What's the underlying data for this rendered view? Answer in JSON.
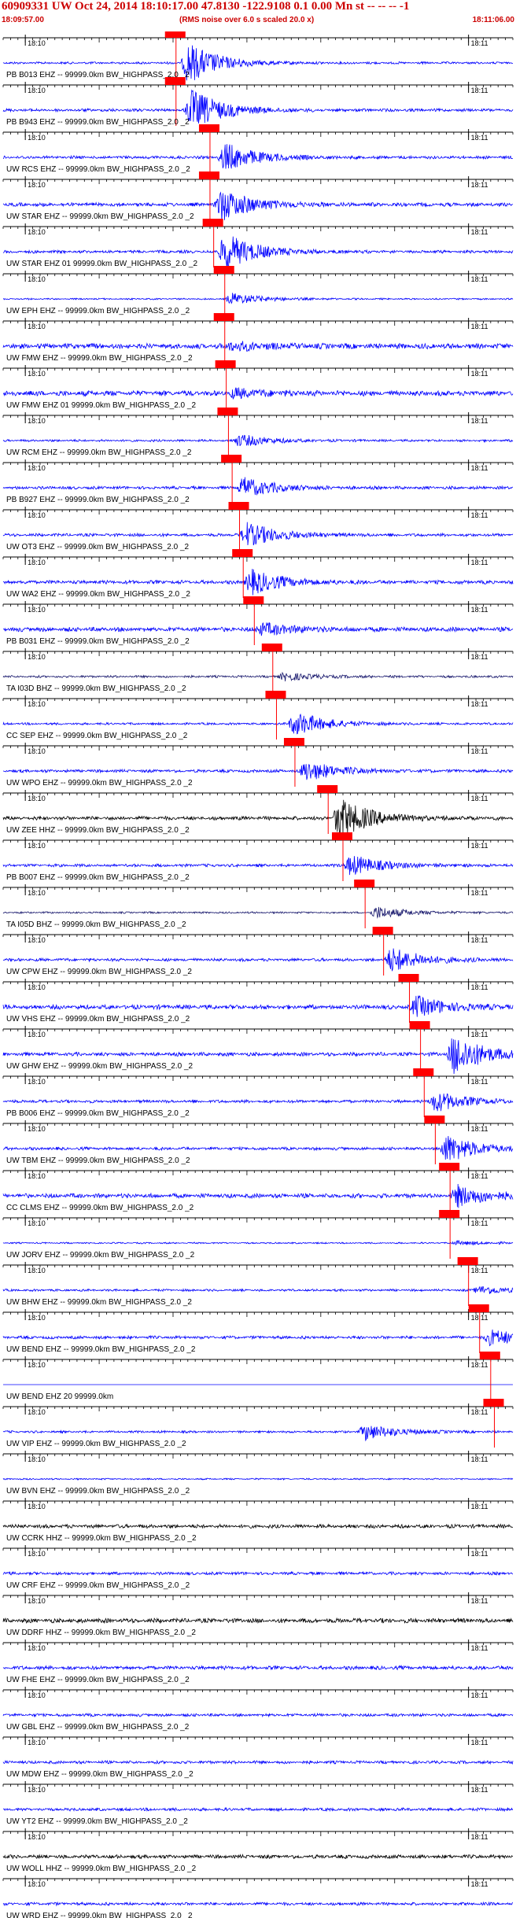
{
  "header": {
    "title": "60909331 UW Oct 24, 2014 18:10:17.00   47.8130 -122.9108  0.1 0.00 Mn st -- -- --  -1",
    "start_time": "18:09:57.00",
    "note": "(RMS noise over 6.0 s scaled 20.0 x)",
    "end_time": "18:11:06.00"
  },
  "colors": {
    "trace_default": "#0000ff",
    "trace_black": "#000000",
    "trace_dark": "#1a1a6e",
    "pick_box": "#ff0000",
    "pick_line": "#ff0000",
    "header_text": "#cc0000",
    "grid": "#000000"
  },
  "chart_data": {
    "type": "line",
    "title": "60909331 UW Oct 24, 2014 18:10:17.00   47.8130 -122.9108  0.1 0.00 Mn st -- -- --  -1",
    "time_window": [
      "18:09:57.00",
      "18:11:06.00"
    ],
    "tick_labels": [
      "18:10",
      "18:11"
    ],
    "ylabel": "",
    "traces": [
      {
        "label": "PB B013 EHZ -- 99999.0km BW_HIGHPASS_2.0 _2",
        "color": "#0000ff",
        "pick": "18:10:20.4",
        "event_time": "18:10:22.0",
        "event_amp": 1.0,
        "noise": 0.15
      },
      {
        "label": "PB B943 EHZ -- 99999.0km BW_HIGHPASS_2.0 _2",
        "color": "#0000ff",
        "pick": "18:10:20.4",
        "event_time": "18:10:22.5",
        "event_amp": 1.0,
        "noise": 0.2
      },
      {
        "label": "UW RCS EHZ -- 99999.0km BW_HIGHPASS_2.0 _2",
        "color": "#0000ff",
        "pick": "18:10:25.0",
        "event_time": "18:10:27.0",
        "event_amp": 0.7,
        "noise": 0.2
      },
      {
        "label": "UW STAR EHZ -- 99999.0km BW_HIGHPASS_2.0 _2",
        "color": "#0000ff",
        "pick": "18:10:25.0",
        "event_time": "18:10:26.5",
        "event_amp": 0.8,
        "noise": 0.25
      },
      {
        "label": "UW STAR EHZ 01 99999.0km BW_HIGHPASS_2.0 _2",
        "color": "#0000ff",
        "pick": "18:10:25.5",
        "event_time": "18:10:27.0",
        "event_amp": 0.9,
        "noise": 0.2
      },
      {
        "label": "UW EPH EHZ -- 99999.0km BW_HIGHPASS_2.0 _2",
        "color": "#0000ff",
        "pick": "18:10:27.0",
        "event_time": "18:10:28.0",
        "event_amp": 0.3,
        "noise": 0.1
      },
      {
        "label": "UW FMW EHZ -- 99999.0km BW_HIGHPASS_2.0 _2",
        "color": "#0000ff",
        "pick": "18:10:27.0",
        "event_time": "18:10:28.0",
        "event_amp": 0.2,
        "noise": 0.35
      },
      {
        "label": "UW FMW EHZ 01 99999.0km BW_HIGHPASS_2.0 _2",
        "color": "#0000ff",
        "pick": "18:10:27.2",
        "event_time": "18:10:28.2",
        "event_amp": 0.2,
        "noise": 0.35
      },
      {
        "label": "UW RCM EHZ -- 99999.0km BW_HIGHPASS_2.0 _2",
        "color": "#0000ff",
        "pick": "18:10:27.5",
        "event_time": "18:10:29.0",
        "event_amp": 0.3,
        "noise": 0.15
      },
      {
        "label": "PB B927 EHZ -- 99999.0km BW_HIGHPASS_2.0 _2",
        "color": "#0000ff",
        "pick": "18:10:28.0",
        "event_time": "18:10:29.5",
        "event_amp": 0.5,
        "noise": 0.2
      },
      {
        "label": "UW OT3 EHZ -- 99999.0km BW_HIGHPASS_2.0 _2",
        "color": "#0000ff",
        "pick": "18:10:29.0",
        "event_time": "18:10:30.0",
        "event_amp": 0.6,
        "noise": 0.2
      },
      {
        "label": "UW WA2 EHZ -- 99999.0km BW_HIGHPASS_2.0 _2",
        "color": "#0000ff",
        "pick": "18:10:29.5",
        "event_time": "18:10:30.5",
        "event_amp": 0.6,
        "noise": 0.25
      },
      {
        "label": "PB B031 EHZ -- 99999.0km BW_HIGHPASS_2.0 _2",
        "color": "#0000ff",
        "pick": "18:10:31.0",
        "event_time": "18:10:32.0",
        "event_amp": 0.3,
        "noise": 0.3
      },
      {
        "label": "TA I03D BHZ -- 99999.0km BW_HIGHPASS_2.0 _2",
        "color": "#1a1a6e",
        "pick": "18:10:33.5",
        "event_time": "18:10:35.0",
        "event_amp": 0.2,
        "noise": 0.15
      },
      {
        "label": "CC SEP EHZ -- 99999.0km BW_HIGHPASS_2.0 _2",
        "color": "#0000ff",
        "pick": "18:10:34.0",
        "event_time": "18:10:36.5",
        "event_amp": 0.6,
        "noise": 0.15
      },
      {
        "label": "UW WPO EHZ -- 99999.0km BW_HIGHPASS_2.0 _2",
        "color": "#0000ff",
        "pick": "18:10:36.5",
        "event_time": "18:10:38.0",
        "event_amp": 0.5,
        "noise": 0.2
      },
      {
        "label": "UW ZEE HHZ -- 99999.0km BW_HIGHPASS_2.0 _2",
        "color": "#000000",
        "pick": "18:10:41.0",
        "event_time": "18:10:42.5",
        "event_amp": 1.0,
        "noise": 0.25
      },
      {
        "label": "PB B007 EHZ -- 99999.0km BW_HIGHPASS_2.0 _2",
        "color": "#0000ff",
        "pick": "18:10:43.0",
        "event_time": "18:10:44.0",
        "event_amp": 0.5,
        "noise": 0.2
      },
      {
        "label": "TA I05D BHZ -- 99999.0km BW_HIGHPASS_2.0 _2",
        "color": "#1a1a6e",
        "pick": "18:10:46.0",
        "event_time": "18:10:47.5",
        "event_amp": 0.3,
        "noise": 0.12
      },
      {
        "label": "UW CPW EHZ -- 99999.0km BW_HIGHPASS_2.0 _2",
        "color": "#0000ff",
        "pick": "18:10:48.5",
        "event_time": "18:10:49.5",
        "event_amp": 0.6,
        "noise": 0.2
      },
      {
        "label": "UW VHS EHZ -- 99999.0km BW_HIGHPASS_2.0 _2",
        "color": "#0000ff",
        "pick": "18:10:52.0",
        "event_time": "18:10:53.0",
        "event_amp": 0.5,
        "noise": 0.3
      },
      {
        "label": "UW GHW EHZ -- 99999.0km BW_HIGHPASS_2.0 _2",
        "color": "#0000ff",
        "pick": "18:10:53.5",
        "event_time": "18:10:58.0",
        "event_amp": 1.0,
        "noise": 0.25
      },
      {
        "label": "PB B006 EHZ -- 99999.0km BW_HIGHPASS_2.0 _2",
        "color": "#0000ff",
        "pick": "18:10:54.0",
        "event_time": "18:10:55.5",
        "event_amp": 0.5,
        "noise": 0.2
      },
      {
        "label": "UW TBM EHZ -- 99999.0km BW_HIGHPASS_2.0 _2",
        "color": "#0000ff",
        "pick": "18:10:55.5",
        "event_time": "18:10:57.0",
        "event_amp": 0.7,
        "noise": 0.2
      },
      {
        "label": "CC CLMS EHZ -- 99999.0km BW_HIGHPASS_2.0 _2",
        "color": "#0000ff",
        "pick": "18:10:57.5",
        "event_time": "18:10:58.5",
        "event_amp": 0.5,
        "noise": 0.3
      },
      {
        "label": "UW JORV EHZ -- 99999.0km BW_HIGHPASS_2.0 _2",
        "color": "#0000ff",
        "pick": "18:10:57.5",
        "event_time": "18:10:58.5",
        "event_amp": 0.1,
        "noise": 0.1
      },
      {
        "label": "UW BHW EHZ -- 99999.0km BW_HIGHPASS_2.0 _2",
        "color": "#0000ff",
        "pick": "18:11:00.0",
        "event_time": "18:11:01.5",
        "event_amp": 0.2,
        "noise": 0.15
      },
      {
        "label": "UW BEND EHZ -- 99999.0km BW_HIGHPASS_2.0 _2",
        "color": "#0000ff",
        "pick": "18:11:01.5",
        "event_time": "18:11:03.0",
        "event_amp": 0.4,
        "noise": 0.2
      },
      {
        "label": "UW BEND EHZ 20 99999.0km",
        "color": "#0000ff",
        "pick": "18:11:03.0",
        "event_time": "18:11:04.0",
        "event_amp": 0.0,
        "noise": 0.0
      },
      {
        "label": "UW VIP EHZ -- 99999.0km BW_HIGHPASS_2.0 _2",
        "color": "#0000ff",
        "pick": "18:11:03.5",
        "event_time": "18:10:46.0",
        "event_amp": 0.4,
        "noise": 0.15
      },
      {
        "label": "UW BVN EHZ -- 99999.0km BW_HIGHPASS_2.0 _2",
        "color": "#0000ff",
        "pick": "",
        "event_time": "",
        "event_amp": 0.0,
        "noise": 0.1
      },
      {
        "label": "UW CCRK HHZ -- 99999.0km BW_HIGHPASS_2.0 _2",
        "color": "#000000",
        "pick": "",
        "event_time": "",
        "event_amp": 0.0,
        "noise": 0.25
      },
      {
        "label": "UW CRF EHZ -- 99999.0km BW_HIGHPASS_2.0 _2",
        "color": "#0000ff",
        "pick": "",
        "event_time": "",
        "event_amp": 0.0,
        "noise": 0.2
      },
      {
        "label": "UW DDRF HHZ -- 99999.0km BW_HIGHPASS_2.0 _2",
        "color": "#000000",
        "pick": "",
        "event_time": "",
        "event_amp": 0.0,
        "noise": 0.3
      },
      {
        "label": "UW FHE EHZ -- 99999.0km BW_HIGHPASS_2.0 _2",
        "color": "#0000ff",
        "pick": "",
        "event_time": "",
        "event_amp": 0.0,
        "noise": 0.25
      },
      {
        "label": "UW GBL EHZ -- 99999.0km BW_HIGHPASS_2.0 _2",
        "color": "#0000ff",
        "pick": "",
        "event_time": "",
        "event_amp": 0.0,
        "noise": 0.2
      },
      {
        "label": "UW MDW EHZ -- 99999.0km BW_HIGHPASS_2.0 _2",
        "color": "#0000ff",
        "pick": "",
        "event_time": "",
        "event_amp": 0.0,
        "noise": 0.2
      },
      {
        "label": "UW YT2 EHZ -- 99999.0km BW_HIGHPASS_2.0 _2",
        "color": "#0000ff",
        "pick": "",
        "event_time": "",
        "event_amp": 0.0,
        "noise": 0.2
      },
      {
        "label": "UW WOLL HHZ -- 99999.0km BW_HIGHPASS_2.0 _2",
        "color": "#000000",
        "pick": "",
        "event_time": "",
        "event_amp": 0.0,
        "noise": 0.25
      },
      {
        "label": "UW WRD EHZ -- 99999.0km BW_HIGHPASS_2.0 _2",
        "color": "#0000ff",
        "pick": "",
        "event_time": "",
        "event_amp": 0.0,
        "noise": 0.2
      }
    ]
  }
}
